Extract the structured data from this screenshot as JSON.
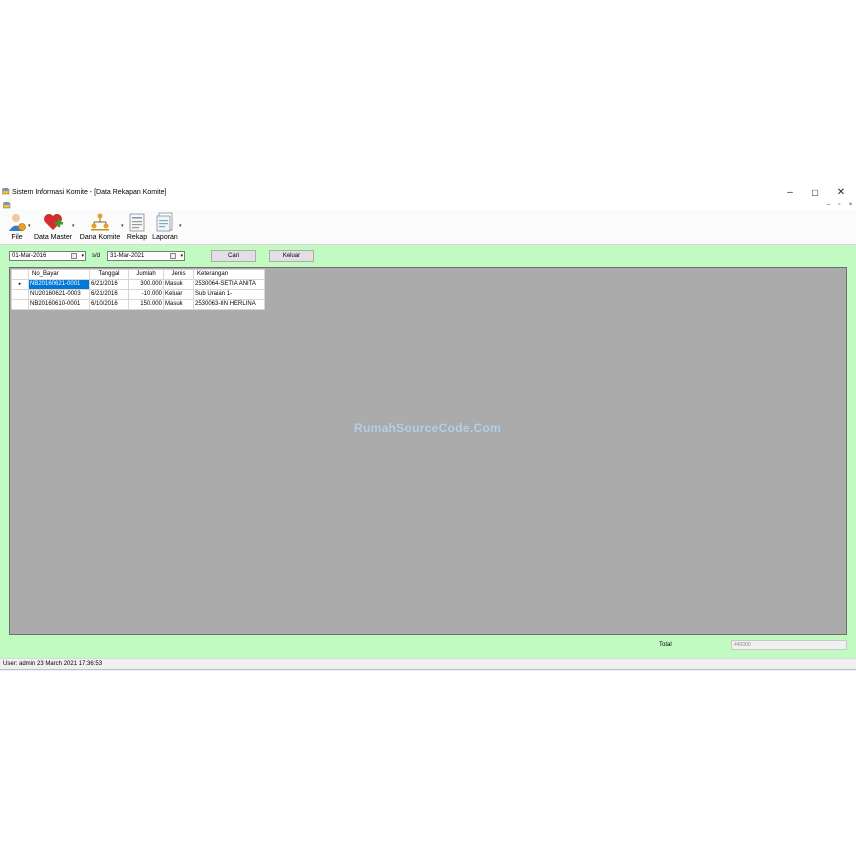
{
  "window": {
    "title": "Sistem Informasi Komite - [Data Rekapan Komite]",
    "controls": {
      "minimize": "–",
      "maximize": "▢",
      "close": "✕"
    },
    "mdi_controls": {
      "minimize": "–",
      "restore": "▫",
      "close": "×"
    }
  },
  "toolbar": {
    "items": [
      {
        "label": "File",
        "icon": "user-icon",
        "dropdown": true
      },
      {
        "label": "Data Master",
        "icon": "heart-plus-icon",
        "dropdown": true
      },
      {
        "label": "Dana Komite",
        "icon": "org-chart-icon",
        "dropdown": true
      },
      {
        "label": "Rekap",
        "icon": "report-icon",
        "dropdown": false
      },
      {
        "label": "Laporan",
        "icon": "document-icon",
        "dropdown": true
      }
    ]
  },
  "filter": {
    "date_from": "01-Mar-2016",
    "separator": "s/d",
    "date_to": "31-Mar-2021",
    "search_label": "Cari",
    "exit_label": "Keluar"
  },
  "grid": {
    "columns": [
      "No_Bayar",
      "Tanggal",
      "Jumlah",
      "Jenis",
      "Keterangan"
    ],
    "rows": [
      [
        "NB20160621-0001",
        "6/21/2016",
        "300.000",
        "Masuk",
        "2530064-SETIA ANITA"
      ],
      [
        "NU20160621-0003",
        "6/21/2016",
        "-10.000",
        "Keluar",
        "Sub Uraian 1-"
      ],
      [
        "NB20160610-0001",
        "6/10/2016",
        "150.000",
        "Masuk",
        "2530063-IIN HERLINA"
      ]
    ],
    "current_row_marker": "▸"
  },
  "watermark": "RumahSourceCode.Com",
  "total": {
    "label": "Total",
    "value": "440000"
  },
  "status": {
    "text": "User: admin  23 March 2021 17:36:53"
  },
  "colors": {
    "form_bg": "#c2fbc2",
    "grid_bg": "#ababab",
    "selection": "#0078d7"
  }
}
